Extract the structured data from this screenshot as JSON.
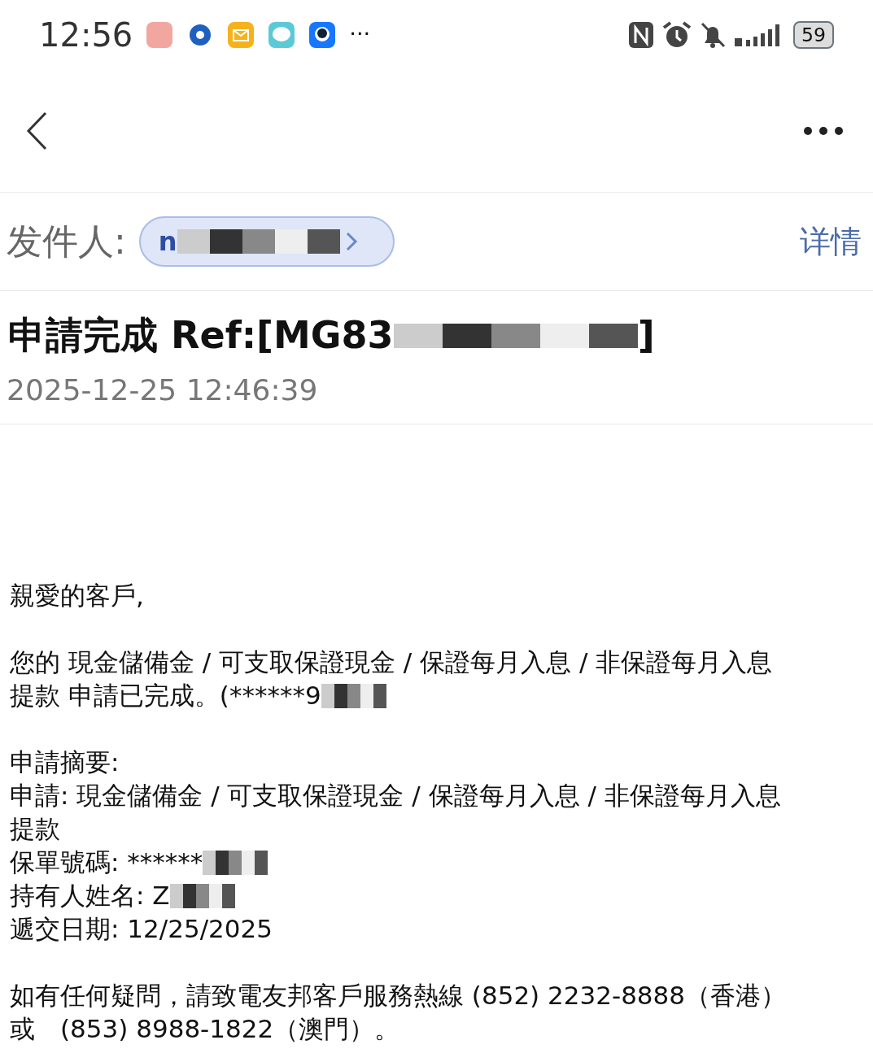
{
  "status_bar": {
    "time": "12:56",
    "more": "···",
    "battery": "59"
  },
  "sender": {
    "label": "发件人:",
    "chip_text": "n",
    "details": "详情"
  },
  "subject": {
    "text": "申請完成 Ref:[MG83",
    "redacted": true,
    "end": "]"
  },
  "date": "2025-12-25 12:46:39",
  "body": [
    [
      {
        "text": "親愛的客戶,",
        "redacted": false
      }
    ],
    [
      {
        "text": "您的 現金儲備金 / 可支取保證現金 / 保證每月入息 / 非保證每月入息",
        "redacted": false
      },
      {
        "text": "提款 申請已完成。(******9",
        "redacted": true
      }
    ],
    [
      {
        "text": "申請摘要:",
        "redacted": false
      },
      {
        "text": "申請: 現金儲備金 / 可支取保證現金 / 保證每月入息 / 非保證每月入息",
        "redacted": false
      },
      {
        "text": "提款",
        "redacted": false
      },
      {
        "text": "保單號碼: ******",
        "redacted": true
      },
      {
        "text": "持有人姓名: Z",
        "redacted": true
      },
      {
        "text": "遞交日期: 12/25/2025",
        "redacted": false
      }
    ],
    [
      {
        "text": "如有任何疑問，請致電友邦客戶服務熱線 (852) 2232-8888（香港）",
        "redacted": false
      },
      {
        "text": "或　(853) 8988-1822（澳門）。",
        "redacted": false
      }
    ]
  ]
}
